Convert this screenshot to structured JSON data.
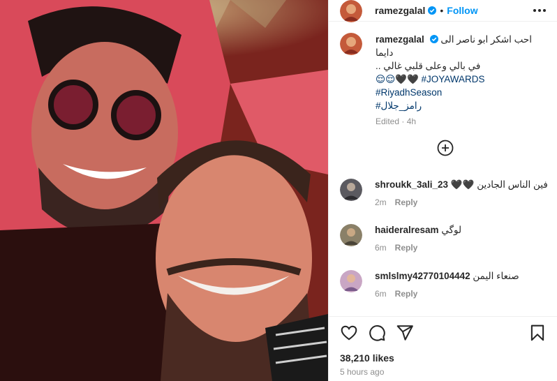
{
  "post": {
    "photo_alt": "Selfie photo of two men"
  },
  "header": {
    "username": "ramezgalal",
    "separator": "•",
    "follow_label": "Follow"
  },
  "caption": {
    "username": "ramezgalal",
    "line1": "احب اشكر ابو ناصر الى دايما",
    "line2": "في بالي وعلى قلبي غالي ..",
    "line3": "😌😌🖤🖤 #JOYAWARDS",
    "hashtag2": "#RiyadhSeason",
    "hashtag3": "#رامز_جلال",
    "edited": "Edited",
    "time": "4h"
  },
  "comments": [
    {
      "username": "shroukk_3ali_23",
      "text": "فين الناس الجادين 🖤🖤",
      "time": "2m",
      "reply": "Reply"
    },
    {
      "username": "haideralresam",
      "text": "لوگي",
      "time": "6m",
      "reply": "Reply"
    },
    {
      "username": "smlslmy42770104442",
      "text": "صنعاء اليمن",
      "time": "6m",
      "reply": "Reply"
    }
  ],
  "footer": {
    "likes": "38,210 likes",
    "time_ago": "5 hours ago"
  },
  "colors": {
    "link_blue": "#0095f6",
    "hashtag": "#00376b",
    "muted": "#8e8e8e"
  }
}
